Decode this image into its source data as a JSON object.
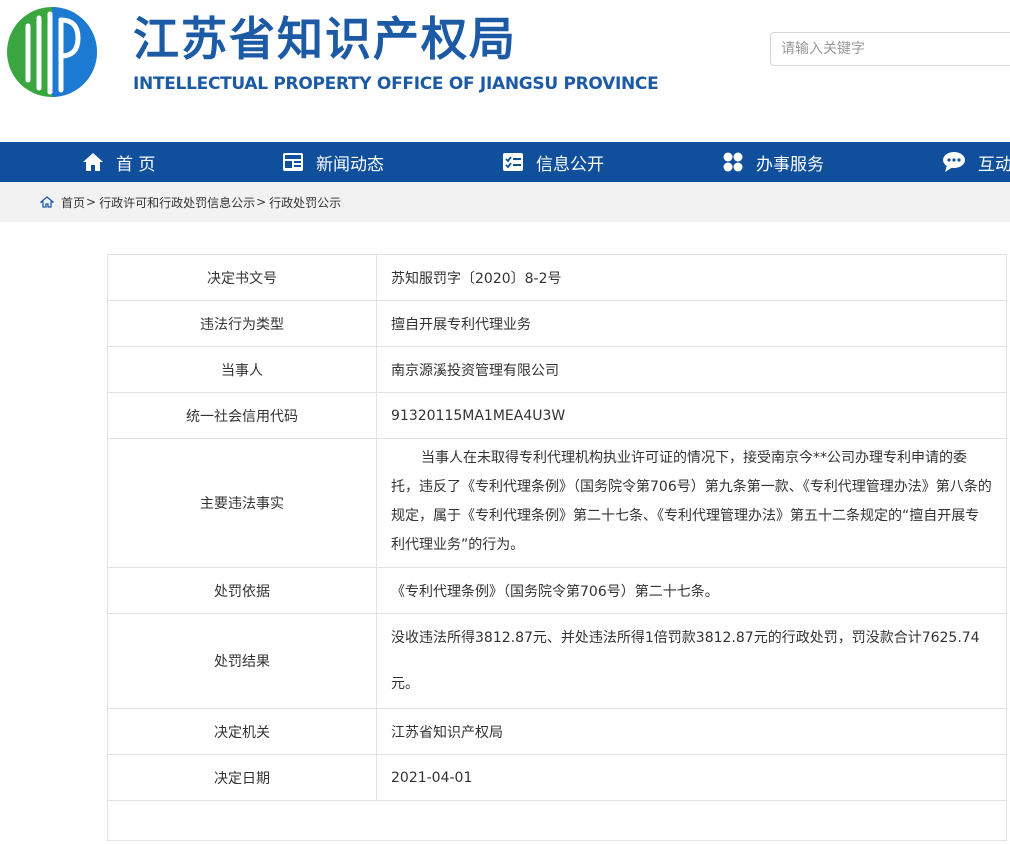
{
  "header": {
    "title_cn": "江苏省知识产权局",
    "title_en": "INTELLECTUAL PROPERTY OFFICE OF JIANGSU PROVINCE",
    "search_placeholder": "请输入关键字"
  },
  "nav": {
    "items": [
      {
        "label": "首 页",
        "icon": "home-icon"
      },
      {
        "label": "新闻动态",
        "icon": "news-icon"
      },
      {
        "label": "信息公开",
        "icon": "info-icon"
      },
      {
        "label": "办事服务",
        "icon": "service-icon"
      },
      {
        "label": "互动",
        "icon": "chat-icon"
      }
    ]
  },
  "breadcrumb": {
    "items": [
      "首页",
      "行政许可和行政处罚信息公示",
      "行政处罚公示"
    ],
    "separator": ">"
  },
  "record": {
    "rows": [
      {
        "key": "决定书文号",
        "value": "苏知服罚字〔2020〕8-2号"
      },
      {
        "key": "违法行为类型",
        "value": "擅自开展专利代理业务"
      },
      {
        "key": "当事人",
        "value": "南京源溪投资管理有限公司"
      },
      {
        "key": "统一社会信用代码",
        "value": "91320115MA1MEA4U3W"
      },
      {
        "key": "主要违法事实",
        "value": "当事人在未取得专利代理机构执业许可证的情况下，接受南京今**公司办理专利申请的委托，违反了《专利代理条例》（国务院令第706号）第九条第一款、《专利代理管理办法》第八条的规定，属于《专利代理条例》第二十七条、《专利代理管理办法》第五十二条规定的“擅自开展专利代理业务”的行为。"
      },
      {
        "key": "处罚依据",
        "value": "《专利代理条例》（国务院令第706号）第二十七条。"
      },
      {
        "key": "处罚结果",
        "value": "没收违法所得3812.87元、并处违法所得1倍罚款3812.87元的行政处罚，罚没款合计7625.74元。"
      },
      {
        "key": "决定机关",
        "value": "江苏省知识产权局"
      },
      {
        "key": "决定日期",
        "value": "2021-04-01"
      }
    ]
  },
  "colors": {
    "brand_blue": "#1d5aa6",
    "nav_bg": "#0f4f9c",
    "logo_green": "#3aa640",
    "logo_blue": "#1d7ad2"
  }
}
